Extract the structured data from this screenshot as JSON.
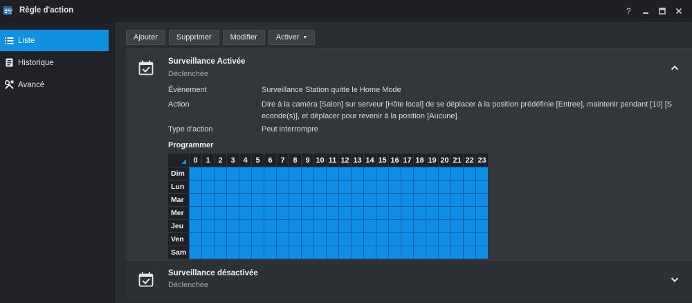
{
  "window": {
    "title": "Règle d'action",
    "controls": [
      "help-icon",
      "minimize-icon",
      "maximize-icon",
      "close-icon"
    ]
  },
  "sidebar": {
    "items": [
      {
        "label": "Liste",
        "icon": "list-icon",
        "active": true
      },
      {
        "label": "Historique",
        "icon": "history-icon",
        "active": false
      },
      {
        "label": "Avancé",
        "icon": "tools-icon",
        "active": false
      }
    ]
  },
  "toolbar": {
    "add_label": "Ajouter",
    "delete_label": "Supprimer",
    "edit_label": "Modifier",
    "activate_label": "Activer"
  },
  "rules": [
    {
      "name": "Surveillance Activée",
      "status": "Déclenchée",
      "expanded": true,
      "details": {
        "event_label": "Évènement",
        "event_value": "Surveillance Station quitte le Home Mode",
        "action_label": "Action",
        "action_line1": "Dire à la caméra [Salon] sur serveur [Hôte local] de se déplacer à la position prédéfinie [Entree], maintenir pendant [10] [S",
        "action_line2": "econde(s)], et déplacer pour revenir à la position [Aucune].",
        "action_type_label": "Type d'action",
        "action_type_value": "Peut interrompre"
      },
      "schedule_title": "Programmer",
      "schedule": {
        "days": [
          "Dim",
          "Lun",
          "Mar",
          "Mer",
          "Jeu",
          "Ven",
          "Sam"
        ],
        "hours": [
          "0",
          "1",
          "2",
          "3",
          "4",
          "5",
          "6",
          "7",
          "8",
          "9",
          "10",
          "11",
          "12",
          "13",
          "14",
          "15",
          "16",
          "17",
          "18",
          "19",
          "20",
          "21",
          "22",
          "23"
        ],
        "all_active": true,
        "active_color": "#0f8ee8"
      }
    },
    {
      "name": "Surveillance désactivée",
      "status": "Déclenchée",
      "expanded": false
    }
  ],
  "colors": {
    "accent": "#1090e0",
    "background": "#2a2d31",
    "sidebar": "#202225"
  }
}
